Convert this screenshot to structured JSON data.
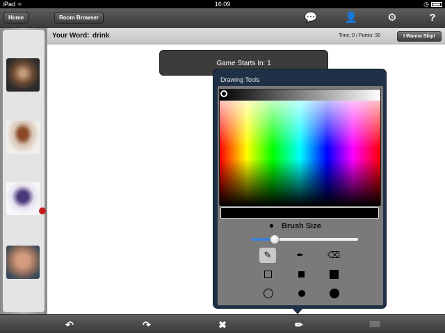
{
  "status_bar": {
    "device": "iPad",
    "time": "16:09"
  },
  "toolbar": {
    "home_label": "Home",
    "room_browser_label": "Room Browser"
  },
  "word_bar": {
    "label": "Your Word:",
    "word": "drink",
    "time_points": "Time: 0 / Points: 30",
    "skip_label": "I Wanna Skip!"
  },
  "countdown": {
    "text": "Game Starts In: 1"
  },
  "drawing_tools": {
    "title": "Drawing Tools",
    "selected_color": "#000000",
    "brush_size_label": "Brush Size",
    "brush_size_fraction": 0.22,
    "tools": [
      "pencil",
      "marker",
      "eraser"
    ],
    "selected_tool": "pencil"
  },
  "colors": {
    "accent_blue": "#3f7fd6",
    "popover_border": "#203046"
  }
}
